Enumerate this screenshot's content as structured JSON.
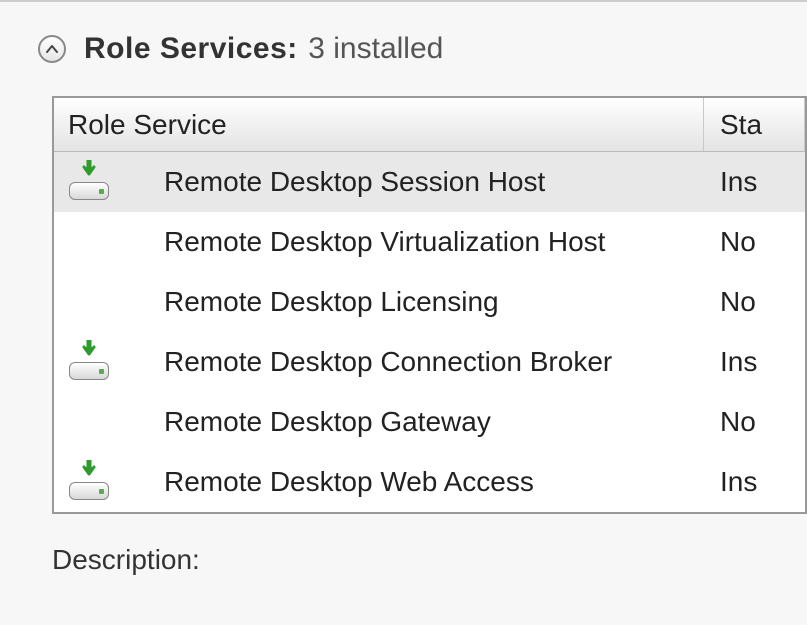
{
  "header": {
    "title": "Role Services:",
    "installed_text": "3 installed"
  },
  "columns": {
    "service": "Role Service",
    "status": "Sta"
  },
  "rows": [
    {
      "name": "Remote Desktop Session Host",
      "status": "Ins",
      "installed": true,
      "selected": true
    },
    {
      "name": "Remote Desktop Virtualization Host",
      "status": "No",
      "installed": false,
      "selected": false
    },
    {
      "name": "Remote Desktop Licensing",
      "status": "No",
      "installed": false,
      "selected": false
    },
    {
      "name": "Remote Desktop Connection Broker",
      "status": "Ins",
      "installed": true,
      "selected": false
    },
    {
      "name": "Remote Desktop Gateway",
      "status": "No",
      "installed": false,
      "selected": false
    },
    {
      "name": "Remote Desktop Web Access",
      "status": "Ins",
      "installed": true,
      "selected": false
    }
  ],
  "description_label": "Description:"
}
